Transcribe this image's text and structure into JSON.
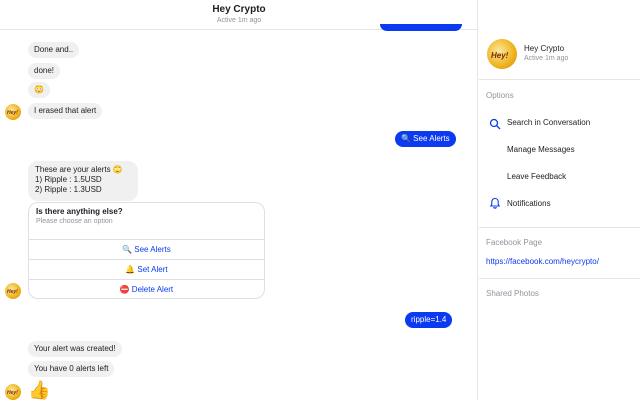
{
  "header": {
    "title": "Hey Crypto",
    "status": "Active 1m ago"
  },
  "messages": [
    {
      "id": "m1",
      "text": "Done and..",
      "dir": "in"
    },
    {
      "id": "m2",
      "text": "done!",
      "dir": "in"
    },
    {
      "id": "m3",
      "text": "😳",
      "dir": "in"
    },
    {
      "id": "m4",
      "text": "I erased that alert",
      "dir": "in"
    },
    {
      "id": "m5",
      "text": "🔍 See Alerts",
      "dir": "out"
    },
    {
      "id": "m6",
      "lines": [
        "These are your alerts 🙄",
        "1) Ripple : 1.5USD",
        "2) Ripple : 1.3USD"
      ],
      "dir": "in"
    },
    {
      "id": "m7",
      "text": "ripple=1.4",
      "dir": "out"
    },
    {
      "id": "m8",
      "text": "Your alert was created!",
      "dir": "in"
    },
    {
      "id": "m9",
      "text": "You have 0 alerts left",
      "dir": "in"
    },
    {
      "id": "m10",
      "text": "👍",
      "dir": "in"
    }
  ],
  "card": {
    "title": "Is there anything else?",
    "subtitle": "Please choose an option",
    "options": [
      {
        "icon": "🔍",
        "label": "See Alerts"
      },
      {
        "icon": "🔔",
        "label": "Set Alert"
      },
      {
        "icon": "⛔",
        "label": "Delete Alert"
      }
    ]
  },
  "sidebar": {
    "avatar_text": "Hey!",
    "name": "Hey Crypto",
    "status": "Active 1m ago",
    "options_heading": "Options",
    "items": [
      {
        "label": "Search in Conversation",
        "icon": "search-icon"
      },
      {
        "label": "Manage Messages",
        "icon": ""
      },
      {
        "label": "Leave Feedback",
        "icon": ""
      },
      {
        "label": "Notifications",
        "icon": "bell-icon"
      }
    ],
    "facebook_heading": "Facebook Page",
    "facebook_link": "https://facebook.com/heycrypto/",
    "shared_heading": "Shared Photos"
  },
  "avatar_text": "Hey!",
  "colors": {
    "accent": "#0b3af0",
    "incoming_bg": "#f1f0f0",
    "muted": "#90949c"
  }
}
